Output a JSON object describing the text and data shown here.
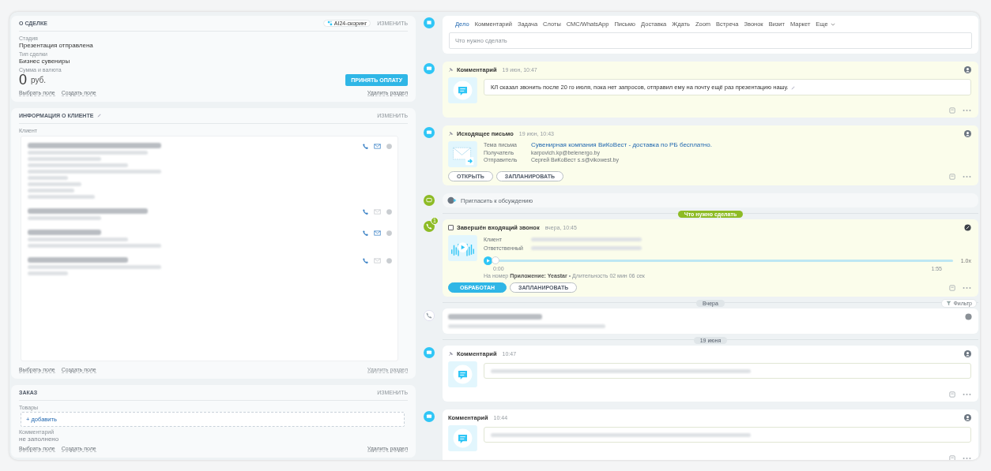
{
  "deal": {
    "title": "О СДЕЛКЕ",
    "badge": "AI24-скоринг",
    "edit": "ИЗМЕНИТЬ",
    "fields": [
      {
        "label": "Стадия",
        "value": "Презентация отправлена"
      },
      {
        "label": "Тип сделки",
        "value": "Бизнес сувениры"
      }
    ],
    "amount_label": "Сумма и валюта",
    "amount": "0",
    "currency": "руб.",
    "pay_button": "ПРИНЯТЬ ОПЛАТУ",
    "links": [
      "Выбрать поле",
      "Создать поле"
    ],
    "delete": "Удалить раздел"
  },
  "client": {
    "title": "ИНФОРМАЦИЯ О КЛИЕНТЕ",
    "edit": "ИЗМЕНИТЬ",
    "label": "Клиент",
    "contacts": [
      {
        "email": true
      },
      {
        "email": false
      },
      {
        "email": true
      },
      {
        "email": false
      }
    ],
    "links": [
      "Выбрать поле",
      "Создать поле"
    ],
    "delete": "Удалить раздел"
  },
  "order": {
    "title": "ЗАКАЗ",
    "edit": "ИЗМЕНИТЬ",
    "products_label": "Товары",
    "add": "+ добавить",
    "comment_label": "Комментарий",
    "comment": "не заполнено",
    "links": [
      "Выбрать поле",
      "Создать поле"
    ],
    "delete": "Удалить раздел"
  },
  "composer": {
    "tabs": [
      {
        "label": "Дело",
        "selected": true
      },
      {
        "label": "Комментарий",
        "selected": false
      },
      {
        "label": "Задача",
        "selected": false
      },
      {
        "label": "Слоты",
        "selected": false
      },
      {
        "label": "СМС/WhatsApp",
        "selected": false
      },
      {
        "label": "Письмо",
        "selected": false
      },
      {
        "label": "Доставка",
        "selected": false
      },
      {
        "label": "Ждать",
        "selected": false
      },
      {
        "label": "Zoom",
        "selected": false
      },
      {
        "label": "Встреча",
        "selected": false
      },
      {
        "label": "Звонок",
        "selected": false
      },
      {
        "label": "Визит",
        "selected": false
      },
      {
        "label": "Маркет",
        "selected": false
      }
    ],
    "more": "Еще",
    "placeholder": "Что нужно сделать"
  },
  "timeline": [
    {
      "kind": "comment",
      "title": "Комментарий",
      "time": "19 июн, 10:47",
      "pinned": true,
      "text": "КЛ сказал звонить после 20 го июля, пока нет запросов, отправил ему на почту ещё раз презентацию нашу.",
      "tint": true
    },
    {
      "kind": "email",
      "title": "Исходящее письмо",
      "time": "19 июн, 10:43",
      "pinned": true,
      "rows": [
        {
          "label": "Тема письма",
          "value": "Сувенирная компания ВиКоВест - доставка по РБ бесплатно.",
          "link": true
        },
        {
          "label": "Получатель",
          "value": "karpovich.kp@belenergo.by",
          "link": false
        },
        {
          "label": "Отправитель",
          "value": "Сергей ВиКоВест s.s@vikowest.by",
          "link": false
        }
      ],
      "buttons": [
        "ОТКРЫТЬ",
        "ЗАПЛАНИРОВАТЬ"
      ]
    },
    {
      "kind": "invite",
      "text": "Пригласить к обсуждению"
    },
    {
      "kind": "separator",
      "text": "Что нужно сделать",
      "accent": true
    },
    {
      "kind": "call",
      "title": "Завершён входящий звонок",
      "time": "вчера, 10:45",
      "badge": "1",
      "checked": false,
      "fields": [
        "Клиент",
        "Ответственный"
      ],
      "start": "0:00",
      "end": "1:55",
      "speed": "1.0x",
      "level": 0,
      "info": "На номер **Приложение: Yeastar** • Длительность 02 мин 06 сек",
      "buttons": [
        {
          "label": "ОБРАБОТАН",
          "primary": true
        },
        {
          "label": "ЗАПЛАНИРОВАТЬ",
          "primary": false
        }
      ]
    },
    {
      "kind": "separator",
      "text": "Вчера",
      "accent": false,
      "filter": "Фильтр"
    },
    {
      "kind": "blurred"
    },
    {
      "kind": "separator",
      "text": "19 июня",
      "accent": false
    },
    {
      "kind": "comment",
      "title": "Комментарий",
      "time": "10:47",
      "pinned": true,
      "tint": false
    },
    {
      "kind": "comment",
      "title": "Комментарий",
      "time": "10:44",
      "pinned": false,
      "tint": false
    }
  ]
}
